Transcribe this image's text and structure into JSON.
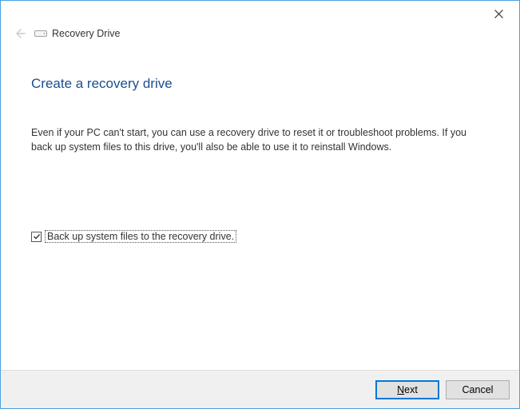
{
  "window": {
    "title": "Recovery Drive"
  },
  "page": {
    "heading": "Create a recovery drive",
    "description": "Even if your PC can't start, you can use a recovery drive to reset it or troubleshoot problems. If you back up system files to this drive, you'll also be able to use it to reinstall Windows."
  },
  "checkbox": {
    "label": "Back up system files to the recovery drive.",
    "checked": true
  },
  "buttons": {
    "next_prefix": "",
    "next_mnemonic": "N",
    "next_suffix": "ext",
    "cancel": "Cancel"
  }
}
